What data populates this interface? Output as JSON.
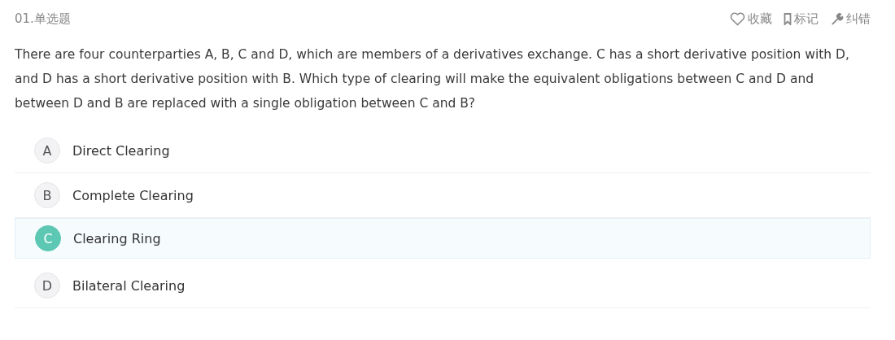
{
  "question": {
    "number": "01.单选题",
    "text": "There are four counterparties A, B, C and D, which are members of a derivatives exchange. C has a short derivative position with D, and D has a short derivative position with B. Which type of clearing will make the equivalent obligations between C and D and between D and B are replaced with a single obligation between C and B?"
  },
  "actions": [
    {
      "kind": "favorite",
      "label": "收藏"
    },
    {
      "kind": "mark",
      "label": "标记"
    },
    {
      "kind": "report",
      "label": "纠错"
    }
  ],
  "options": [
    {
      "letter": "A",
      "text": "Direct Clearing",
      "selected": false
    },
    {
      "letter": "B",
      "text": "Complete Clearing",
      "selected": false
    },
    {
      "letter": "C",
      "text": "Clearing Ring",
      "selected": true
    },
    {
      "letter": "D",
      "text": "Bilateral Clearing",
      "selected": false
    }
  ]
}
